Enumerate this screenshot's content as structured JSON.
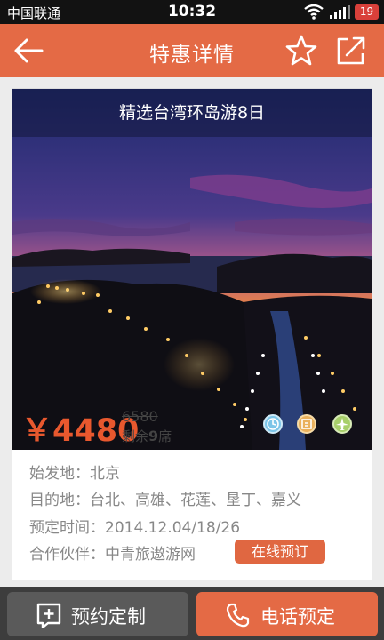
{
  "status_bar": {
    "carrier": "中国联通",
    "time": "10:32",
    "battery": "19"
  },
  "header": {
    "title": "特惠详情",
    "icons": [
      "back-arrow-icon",
      "star-icon",
      "share-icon"
    ]
  },
  "deal": {
    "banner_title": "精选台湾环岛游8日",
    "price": "￥4480",
    "original_price": "6580",
    "seats_prefix": "剩余",
    "seats_count": "9",
    "seats_suffix": "席",
    "feature_icons": [
      "clock-icon",
      "hotel-icon",
      "flight-icon"
    ],
    "departure": "始发地：北京",
    "destinations": "目的地：台北、高雄、花莲、垦丁、嘉义",
    "booking_time": "预定时间：2014.12.04/18/26",
    "partner": "合作伙伴：中青旅遨游网",
    "book_online_label": "在线预订"
  },
  "bottom_bar": {
    "custom_label": "预约定制",
    "phone_label": "电话预定"
  },
  "colors": {
    "accent": "#e46a45",
    "price": "#e8582e",
    "status_bar": "#121212",
    "bottom_bar": "#3d3d3d"
  }
}
